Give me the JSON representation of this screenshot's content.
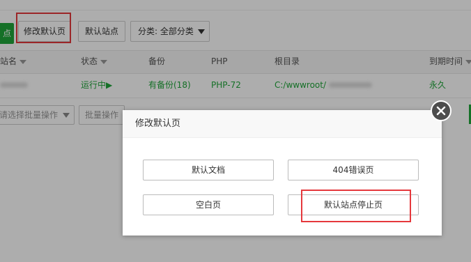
{
  "toolbar": {
    "add_site_tail": "点",
    "modify_default_page": "修改默认页",
    "default_site": "默认站点",
    "category_select": "分类: 全部分类"
  },
  "table": {
    "headers": {
      "site_name": "网站名",
      "status": "状态",
      "backup": "备份",
      "php": "PHP",
      "root_dir": "根目录",
      "expire": "到期时间"
    },
    "row": {
      "status": "运行中▶",
      "backup": "有备份(18)",
      "php": "PHP-72",
      "root": "C:/wwwroot/",
      "expire": "永久"
    }
  },
  "batch": {
    "select_placeholder": "请选择批量操作",
    "batch_button": "批量操作"
  },
  "dialog": {
    "title": "修改默认页",
    "options": [
      "默认文档",
      "404错误页",
      "空白页",
      "默认站点停止页"
    ]
  },
  "colors": {
    "green": "#20a53a",
    "highlight_red": "#e5383c"
  }
}
